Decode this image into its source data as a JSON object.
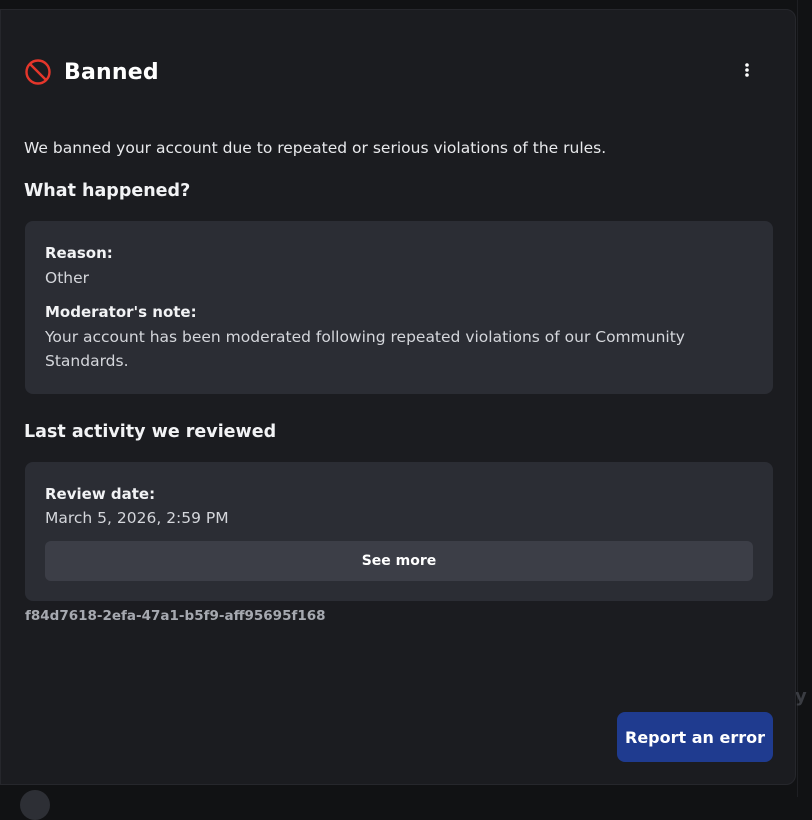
{
  "modal": {
    "title": "Banned",
    "subtitle": "We banned your account due to repeated or serious violations of the rules.",
    "icons": {
      "status": "no-entry-icon",
      "menu": "more-vertical-icon"
    },
    "colors": {
      "status_icon": "#e5362b",
      "primary_button": "#1f3b8f"
    }
  },
  "what_happened": {
    "heading": "What happened?",
    "reason_label": "Reason:",
    "reason_value": "Other",
    "note_label": "Moderator's note:",
    "note_value": "Your account has been moderated following repeated violations of our Community Standards."
  },
  "last_activity": {
    "heading": "Last activity we reviewed",
    "review_date_label": "Review date:",
    "review_date_value": "March 5, 2026, 2:59 PM",
    "see_more_label": "See more"
  },
  "trace_id": "f84d7618-2efa-47a1-b5f9-aff95695f168",
  "actions": {
    "report_label": "Report an error"
  }
}
